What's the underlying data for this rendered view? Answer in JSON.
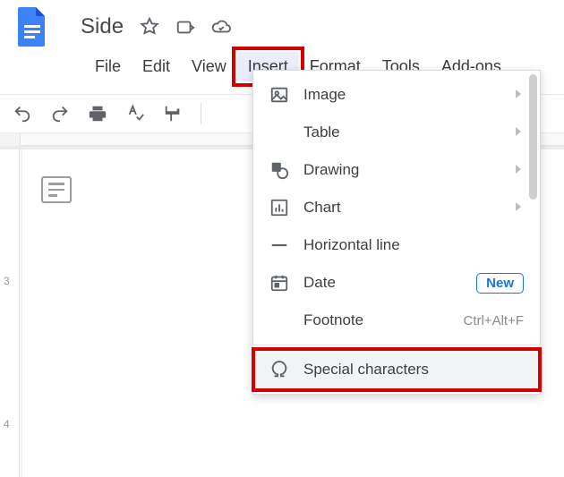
{
  "doc_title": "Side",
  "menus": {
    "file": "File",
    "edit": "Edit",
    "view": "View",
    "insert": "Insert",
    "format": "Format",
    "tools": "Tools",
    "addons": "Add-ons"
  },
  "ruler": {
    "mark3": "3",
    "mark4": "4"
  },
  "insert_menu": {
    "image": "Image",
    "table": "Table",
    "drawing": "Drawing",
    "chart": "Chart",
    "hline": "Horizontal line",
    "date": "Date",
    "date_badge": "New",
    "footnote": "Footnote",
    "footnote_shortcut": "Ctrl+Alt+F",
    "special": "Special characters"
  }
}
